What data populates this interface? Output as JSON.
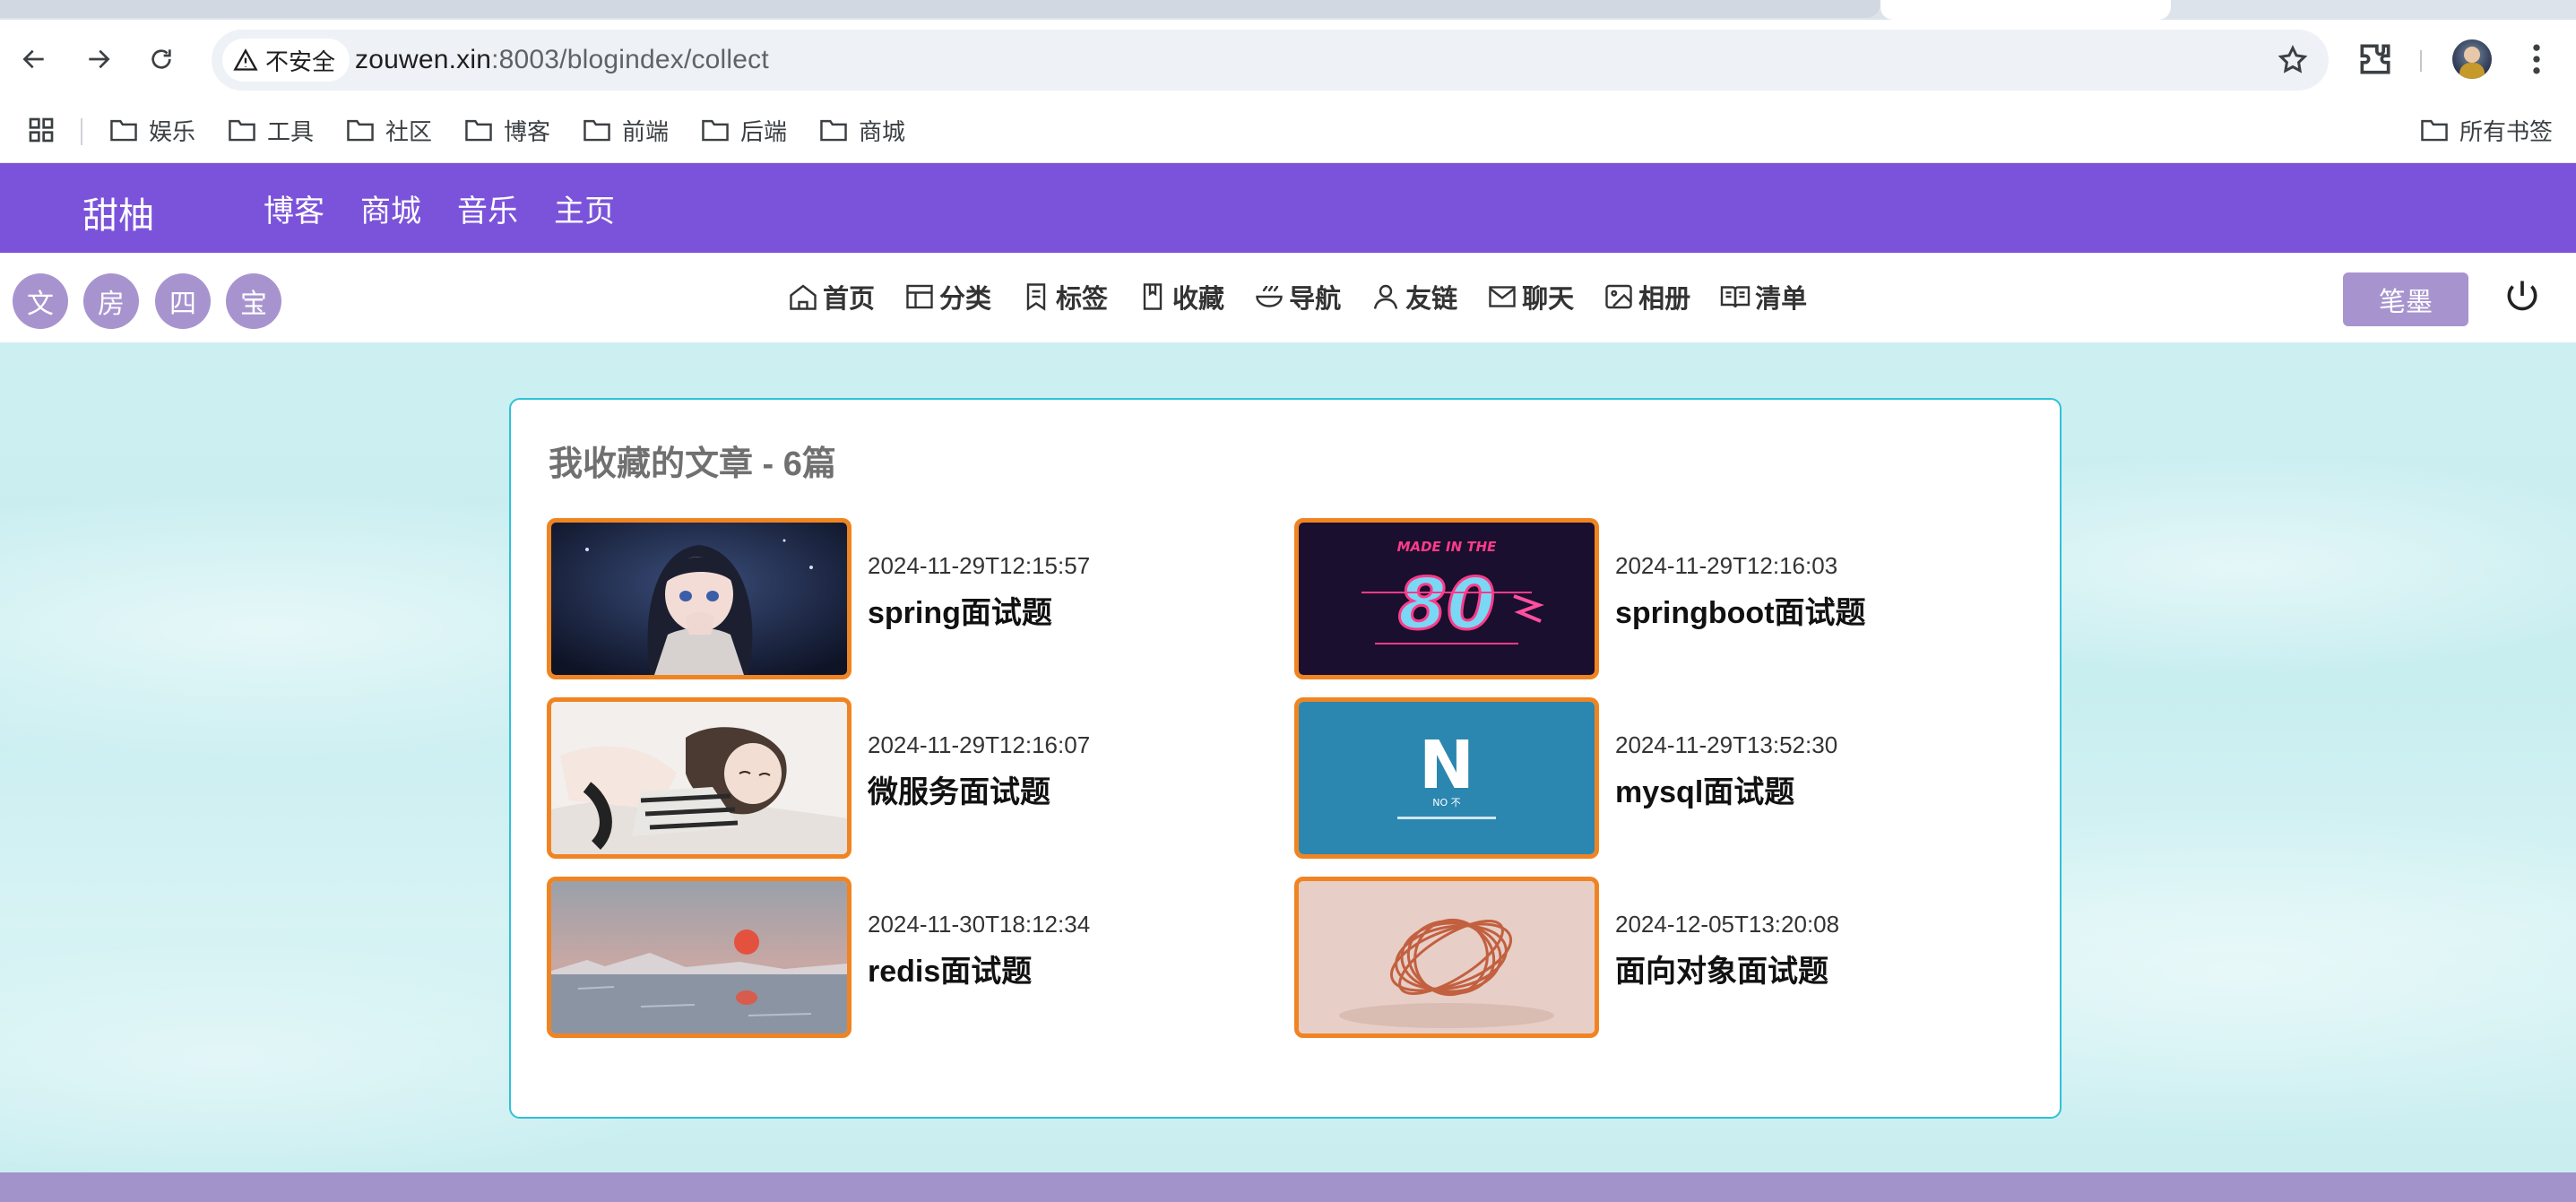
{
  "browser": {
    "security_label": "不安全",
    "url_host": "zouwen.xin",
    "url_rest": ":8003/blogindex/collect",
    "bookmarks": [
      "娱乐",
      "工具",
      "社区",
      "博客",
      "前端",
      "后端",
      "商城"
    ],
    "all_bookmarks": "所有书签"
  },
  "site": {
    "logo": "甜柚",
    "nav": [
      "博客",
      "商城",
      "音乐",
      "主页"
    ],
    "circles": [
      "文",
      "房",
      "四",
      "宝"
    ],
    "menu": [
      "首页",
      "分类",
      "标签",
      "收藏",
      "导航",
      "友链",
      "聊天",
      "相册",
      "清单"
    ],
    "pen_button": "笔墨"
  },
  "panel": {
    "title": "我收藏的文章 - 6篇",
    "posts": [
      {
        "date": "2024-11-29T12:15:57",
        "title": "spring面试题",
        "thumb": "anime-girl-dark-icon"
      },
      {
        "date": "2024-11-29T12:16:03",
        "title": "springboot面试题",
        "thumb": "retro-made-in-the-80s-icon",
        "thumb_text_top": "MADE IN THE",
        "thumb_text_main": "80"
      },
      {
        "date": "2024-11-29T12:16:07",
        "title": "微服务面试题",
        "thumb": "anime-sleeping-icon"
      },
      {
        "date": "2024-11-29T13:52:30",
        "title": "mysql面试题",
        "thumb": "nuxt-logo-icon",
        "thumb_text_main": "N",
        "thumb_text_sub": "NO 不"
      },
      {
        "date": "2024-11-30T18:12:34",
        "title": "redis面试题",
        "thumb": "sunset-sea-icon"
      },
      {
        "date": "2024-12-05T13:20:08",
        "title": "面向对象面试题",
        "thumb": "copper-rings-icon"
      }
    ]
  },
  "colors": {
    "header": "#7b53db",
    "accent_light": "#a794cf",
    "panel_border": "#2fc2d6",
    "thumb_border": "#f08422"
  }
}
